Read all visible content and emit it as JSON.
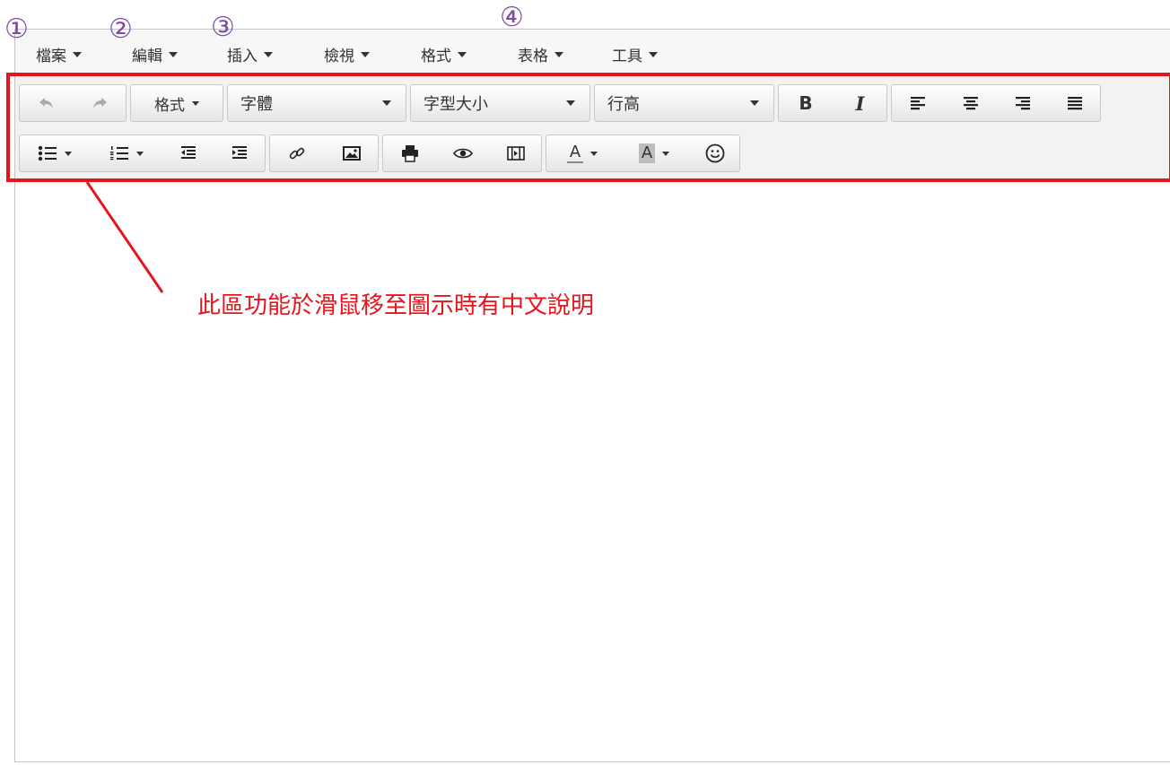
{
  "menubar": {
    "items": [
      {
        "label": "檔案"
      },
      {
        "label": "編輯"
      },
      {
        "label": "插入"
      },
      {
        "label": "檢視"
      },
      {
        "label": "格式"
      },
      {
        "label": "表格"
      },
      {
        "label": "工具"
      }
    ]
  },
  "markers": [
    "①",
    "②",
    "③",
    "④"
  ],
  "toolbar": {
    "row1": {
      "undo_icon": "undo-icon",
      "redo_icon": "redo-icon",
      "format_label": "格式",
      "font_family_label": "字體",
      "font_size_label": "字型大小",
      "line_height_label": "行高",
      "bold_label": "B",
      "italic_label": "I"
    },
    "row2": {
      "text_color_label": "A",
      "bg_color_label": "A"
    }
  },
  "annotation": {
    "text": "此區功能於滑鼠移至圖示時有中文說明"
  },
  "colors": {
    "highlight": "#e8141b",
    "marker": "#7d4a9f",
    "toolbar_bg": "#f2f2f2"
  }
}
